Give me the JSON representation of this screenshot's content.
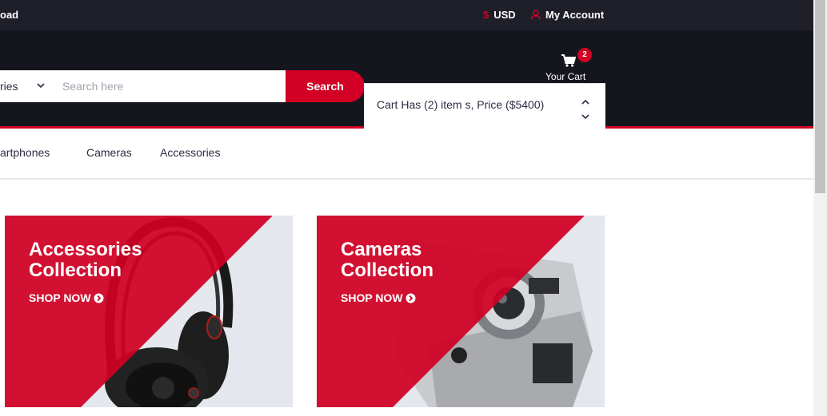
{
  "topbar": {
    "left_text": "oad",
    "currency_symbol": "$",
    "currency": "USD",
    "account": "My Account"
  },
  "search": {
    "category": "ries",
    "placeholder": "Search here",
    "button": "Search"
  },
  "cart": {
    "count": "2",
    "label": "Your Cart",
    "summary": "Cart Has (2) item s, Price ($5400)"
  },
  "nav": {
    "items": [
      "artphones",
      "Cameras",
      "Accessories"
    ]
  },
  "collections": [
    {
      "title_line1": "Accessories",
      "title_line2": "Collection",
      "cta": "SHOP NOW"
    },
    {
      "title_line1": "Cameras",
      "title_line2": "Collection",
      "cta": "SHOP NOW"
    }
  ],
  "colors": {
    "accent": "#d10024",
    "dark": "#15161d",
    "topbar": "#1e1f29"
  }
}
